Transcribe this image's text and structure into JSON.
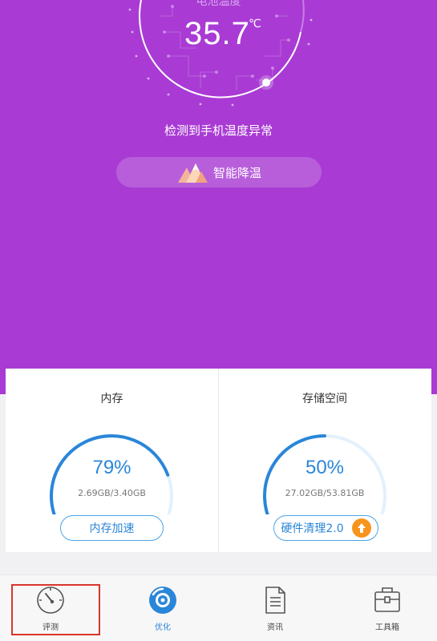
{
  "header": {
    "temp_caption": "电池温度",
    "temp_value": "35.7",
    "temp_unit": "℃",
    "alert": "检测到手机温度异常",
    "cool_button": "智能降温"
  },
  "cards": [
    {
      "title": "内存",
      "percent": "79%",
      "used_total": "2.69GB/3.40GB",
      "button": "内存加速",
      "level": 0.79
    },
    {
      "title": "存储空间",
      "percent": "50%",
      "used_total": "27.02GB/53.81GB",
      "button": "硬件清理2.0",
      "level": 0.5
    }
  ],
  "tabs": [
    {
      "label": "评测",
      "icon": "speedometer-icon",
      "active": false
    },
    {
      "label": "优化",
      "icon": "disc-icon",
      "active": true
    },
    {
      "label": "资讯",
      "icon": "document-icon",
      "active": false
    },
    {
      "label": "工具箱",
      "icon": "toolbox-icon",
      "active": false
    }
  ],
  "colors": {
    "hero_bg": "#a93bd4",
    "accent_blue": "#2a86d8",
    "gauge_track": "#e3f1fd",
    "badge_orange": "#f7941d",
    "highlight_red": "#d9352b"
  }
}
